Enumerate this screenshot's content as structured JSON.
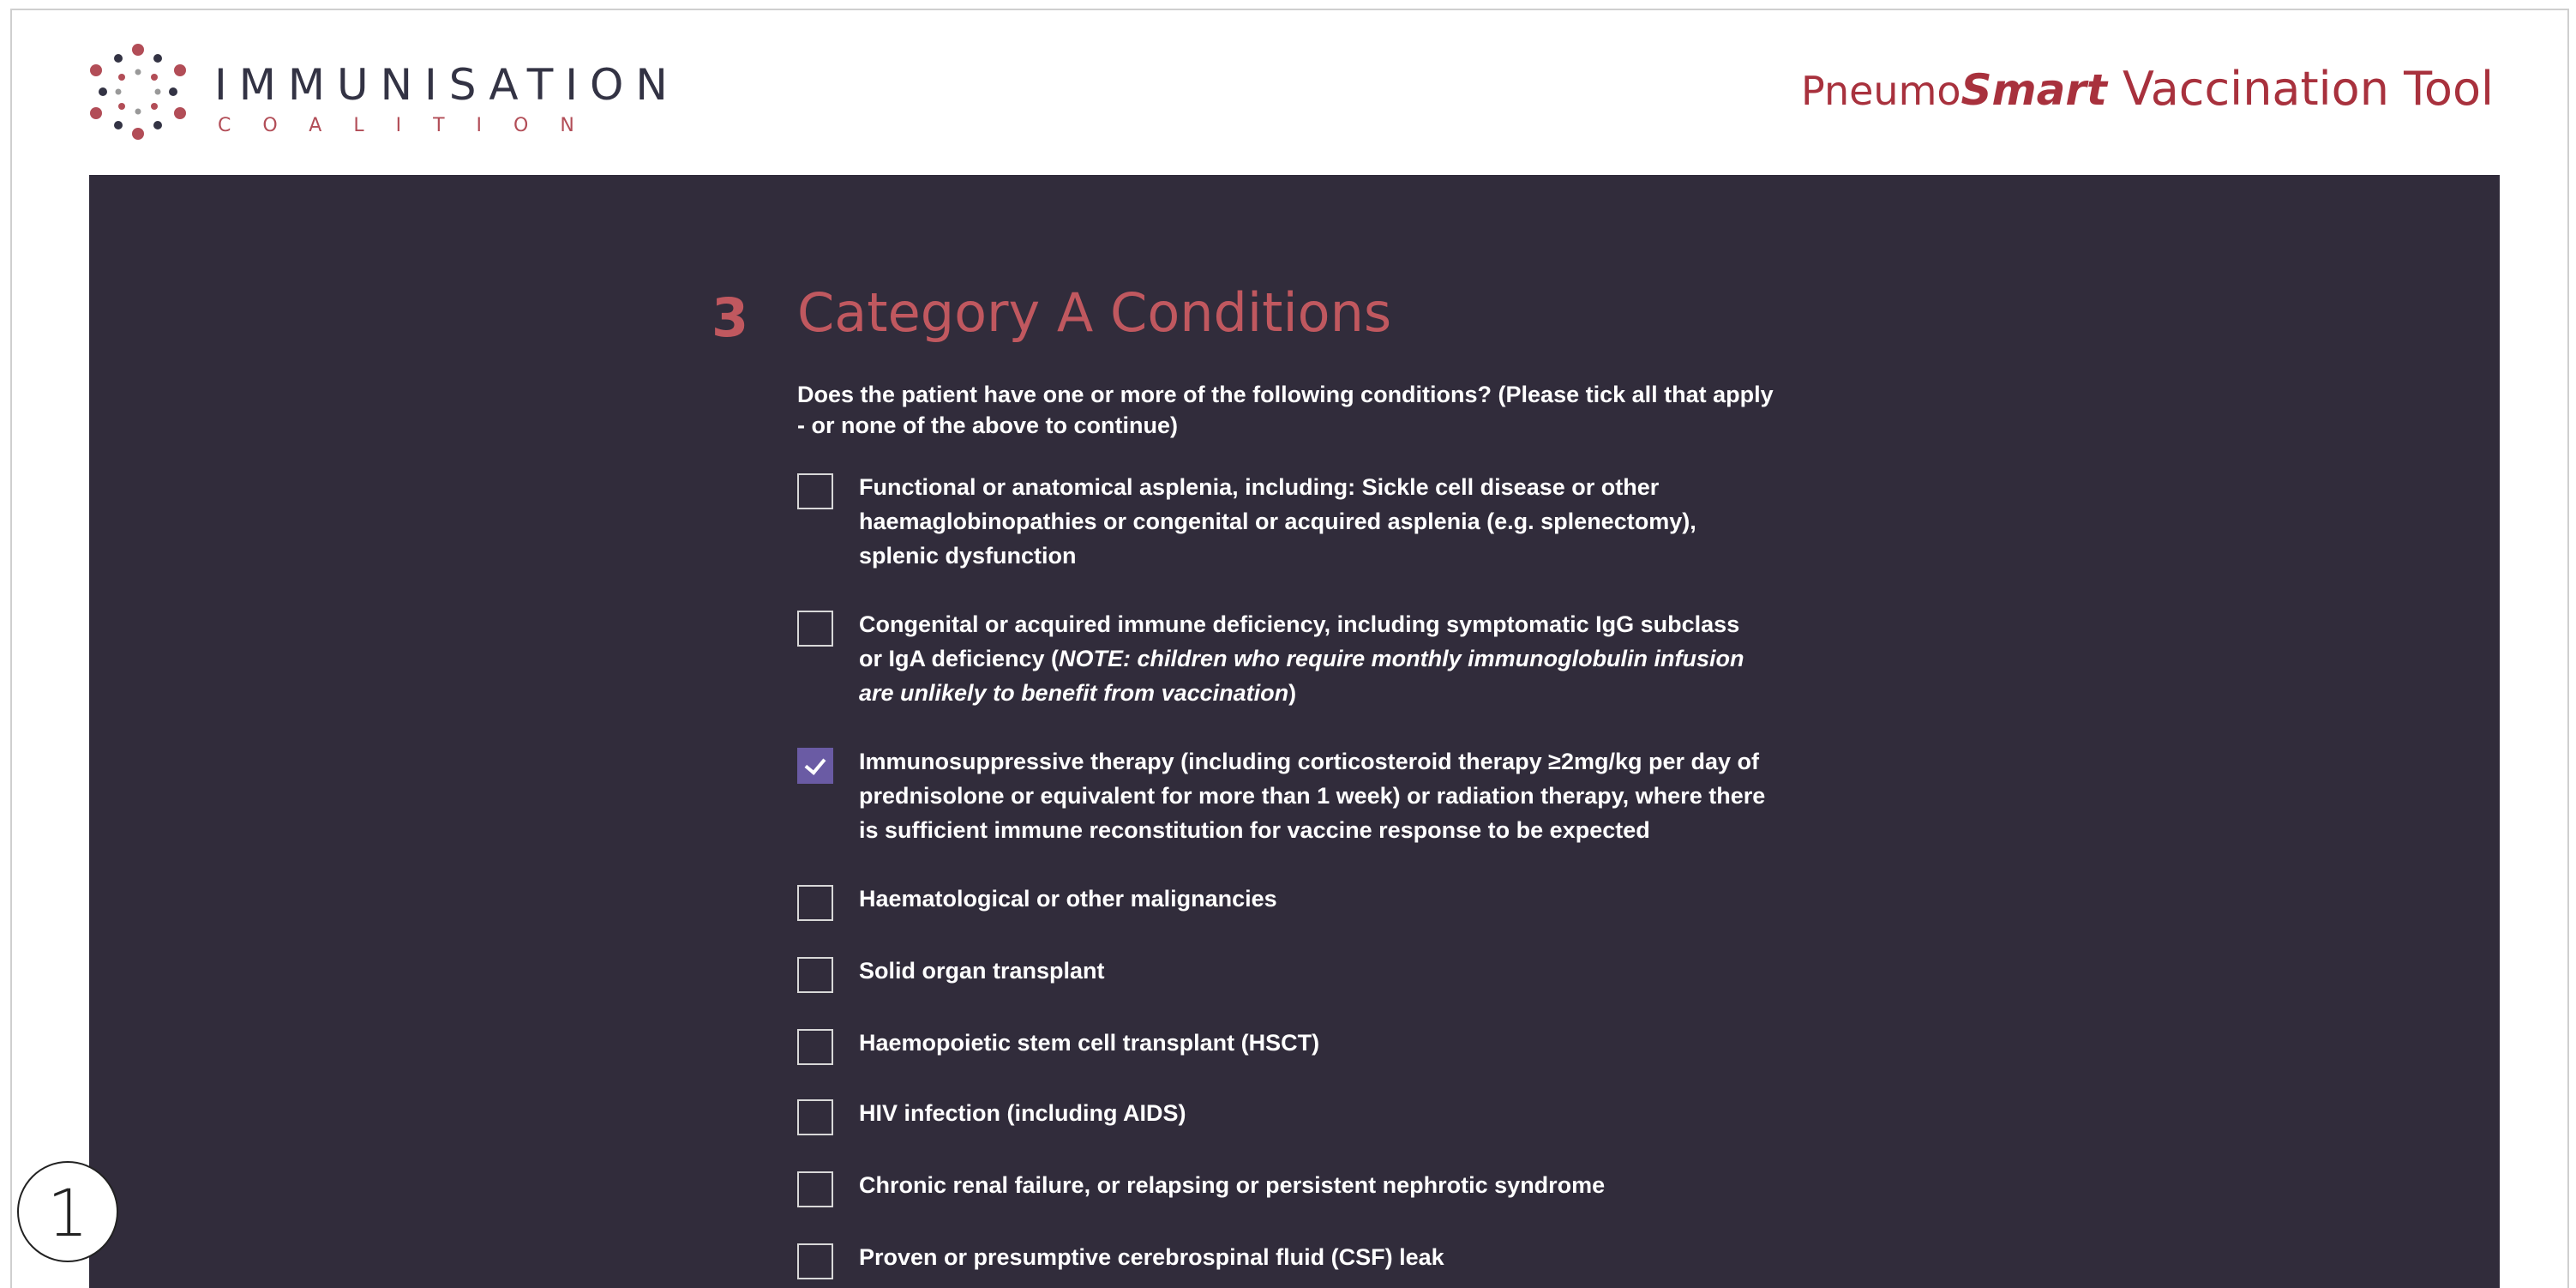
{
  "header": {
    "logo": {
      "title": "IMMUNISATION",
      "subtitle": "COALITION"
    },
    "brand": {
      "part1": "Pneumo",
      "part2": "Smart",
      "part3": "Vaccination Tool",
      "color": "#a8313d"
    }
  },
  "section": {
    "number": "3",
    "title": "Category A Conditions",
    "question": "Does the patient have one or more of the following conditions? (Please tick all that apply - or none of the above to continue)"
  },
  "conditions": [
    {
      "label": "Functional or anatomical asplenia, including: Sickle cell disease or other haemaglobinopathies or congenital or acquired asplenia (e.g. splenectomy), splenic dysfunction",
      "checked": false
    },
    {
      "label_before": "Congenital or acquired immune deficiency, including symptomatic IgG subclass or IgA deficiency (",
      "label_note": "NOTE: children who require monthly immunoglobulin infusion are unlikely to benefit from vaccination",
      "label_after": ")",
      "checked": false
    },
    {
      "label": "Immunosuppressive therapy (including corticosteroid therapy ≥2mg/kg per day of prednisolone or equivalent for more than 1 week) or radiation therapy, where there is sufficient immune reconstitution for vaccine response to be expected",
      "checked": true
    },
    {
      "label": "Haematological or other malignancies",
      "checked": false
    },
    {
      "label": "Solid organ transplant",
      "checked": false
    },
    {
      "label": "Haemopoietic stem cell transplant (HSCT)",
      "checked": false
    },
    {
      "label": "HIV infection (including AIDS)",
      "checked": false
    },
    {
      "label": "Chronic renal failure, or relapsing or persistent nephrotic syndrome",
      "checked": false
    },
    {
      "label": "Proven or presumptive cerebrospinal fluid (CSF) leak",
      "checked": false
    }
  ],
  "step_badge": "1",
  "colors": {
    "panel": "#312c3b",
    "accent": "#c0585f",
    "checkbox_checked": "#6a5ba4"
  }
}
